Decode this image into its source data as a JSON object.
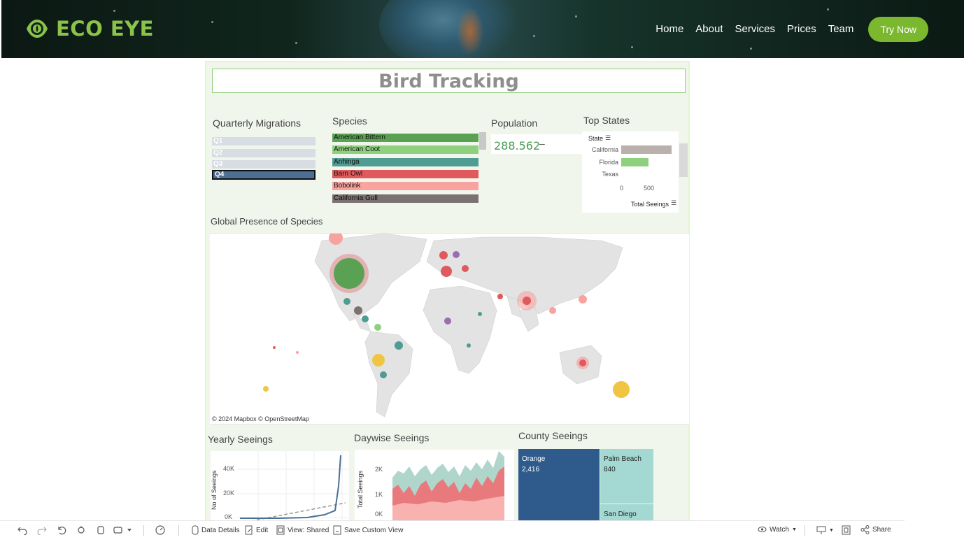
{
  "header": {
    "logo_text": "ECO EYE",
    "nav": [
      "Home",
      "About",
      "Services",
      "Prices",
      "Team"
    ],
    "cta": "Try Now",
    "colors": {
      "brand": "#8bc34a",
      "cta": "#7cb82f"
    }
  },
  "dashboard": {
    "title": "Bird Tracking",
    "quarterly": {
      "title": "Quarterly Migrations",
      "items": [
        "Q1",
        "Q2",
        "Q3",
        "Q4"
      ],
      "selected": "Q4"
    },
    "species": {
      "title": "Species",
      "items": [
        {
          "label": "American Bittern",
          "color": "#5aa153"
        },
        {
          "label": "American Coot",
          "color": "#8fd07e"
        },
        {
          "label": "Anhinga",
          "color": "#4f9c93"
        },
        {
          "label": "Barn Owl",
          "color": "#e05a5d"
        },
        {
          "label": "Bobolink",
          "color": "#f7a3a0"
        },
        {
          "label": "California Gull",
          "color": "#7a7170"
        }
      ]
    },
    "population": {
      "title": "Population",
      "value": "288.562",
      "dash": "–"
    },
    "top_states": {
      "title": "Top States",
      "state_header": "State",
      "measure": "Total Seeings",
      "ticks": [
        "0",
        "500"
      ],
      "rows": [
        {
          "label": "California",
          "value": 780,
          "color": "#bab0ac"
        },
        {
          "label": "Florida",
          "value": 420,
          "color": "#8fd07e"
        },
        {
          "label": "Texas",
          "value": 0,
          "color": "#8fd07e"
        }
      ]
    },
    "map": {
      "title": "Global Presence of Species",
      "credit": "© 2024 Mapbox © OpenStreetMap"
    },
    "yearly": {
      "title": "Yearly Seeings",
      "ylabel": "No of Seeings",
      "yticks": [
        "40K",
        "20K",
        "0K"
      ]
    },
    "daywise": {
      "title": "Daywise Seeings",
      "ylabel": "Total Seeings",
      "yticks": [
        "2K",
        "1K",
        "0K"
      ]
    },
    "county": {
      "title": "County Seeings",
      "cells": [
        {
          "name": "Orange",
          "value": "2,416",
          "color": "#2e5b8c"
        },
        {
          "name": "Palm Beach",
          "value": "840",
          "color": "#a3d9d2"
        },
        {
          "name": "San Diego",
          "value": "",
          "color": "#a3d9d2"
        }
      ]
    }
  },
  "toolbar": {
    "data_details": "Data Details",
    "edit": "Edit",
    "view": "View: Shared",
    "save_view": "Save Custom View",
    "watch": "Watch",
    "share": "Share"
  }
}
